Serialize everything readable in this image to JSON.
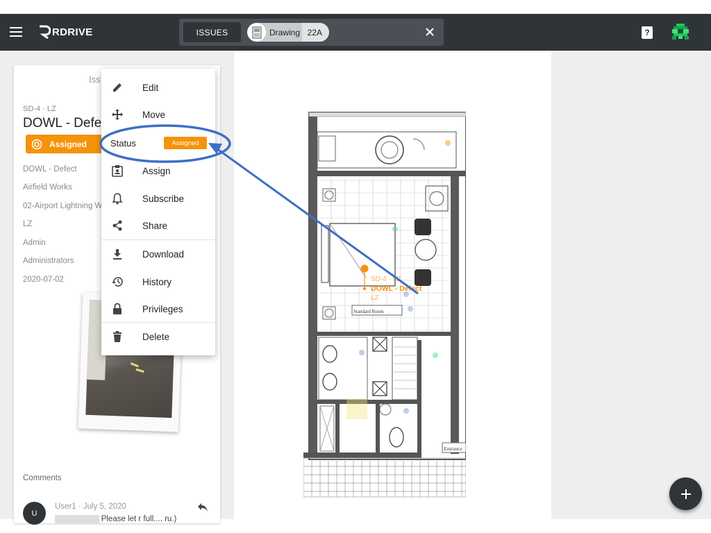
{
  "header": {
    "logo_text": "RDRIVE",
    "search": {
      "issues_label": "ISSUES",
      "chip_label": "Drawing",
      "chip_count": "22A"
    },
    "help_glyph": "?"
  },
  "panel": {
    "header_text": "Iss",
    "ref": "SD-4 · LZ",
    "title": "DOWL - Defec",
    "status_label": "Assigned",
    "fields": [
      "DOWL - Defect",
      "Airfield Works",
      "02-Airport Lightning W",
      "LZ",
      "Admin",
      "Administrators",
      "2020-07-02"
    ],
    "comments_label": "Comments",
    "comment": {
      "avatar_letter": "U",
      "meta": "User1 · July 5, 2020",
      "text": "Please let r full.... ru.)"
    }
  },
  "menu": {
    "items": [
      {
        "label": "Edit",
        "icon": "pencil-icon"
      },
      {
        "label": "Move",
        "icon": "move-arrows-icon"
      },
      {
        "label": "Status",
        "icon": "none",
        "chip": "Assigned"
      },
      {
        "label": "Assign",
        "icon": "clipboard-user-icon"
      },
      {
        "label": "Subscribe",
        "icon": "bell-icon"
      },
      {
        "label": "Share",
        "icon": "share-icon"
      },
      {
        "label": "Download",
        "icon": "download-icon"
      },
      {
        "label": "History",
        "icon": "history-icon"
      },
      {
        "label": "Privileges",
        "icon": "lock-icon"
      },
      {
        "label": "Delete",
        "icon": "trash-icon"
      }
    ]
  },
  "plan": {
    "pin_ref": "SD-4 · LZ",
    "pin_title": "DOWL - Defect",
    "pin_sub": "LZ",
    "room_label": "Standard Room",
    "entrance_label": "Entrance"
  },
  "colors": {
    "topbar": "#2f3438",
    "accent": "#f5930a",
    "annotation": "#3d6fc4"
  }
}
